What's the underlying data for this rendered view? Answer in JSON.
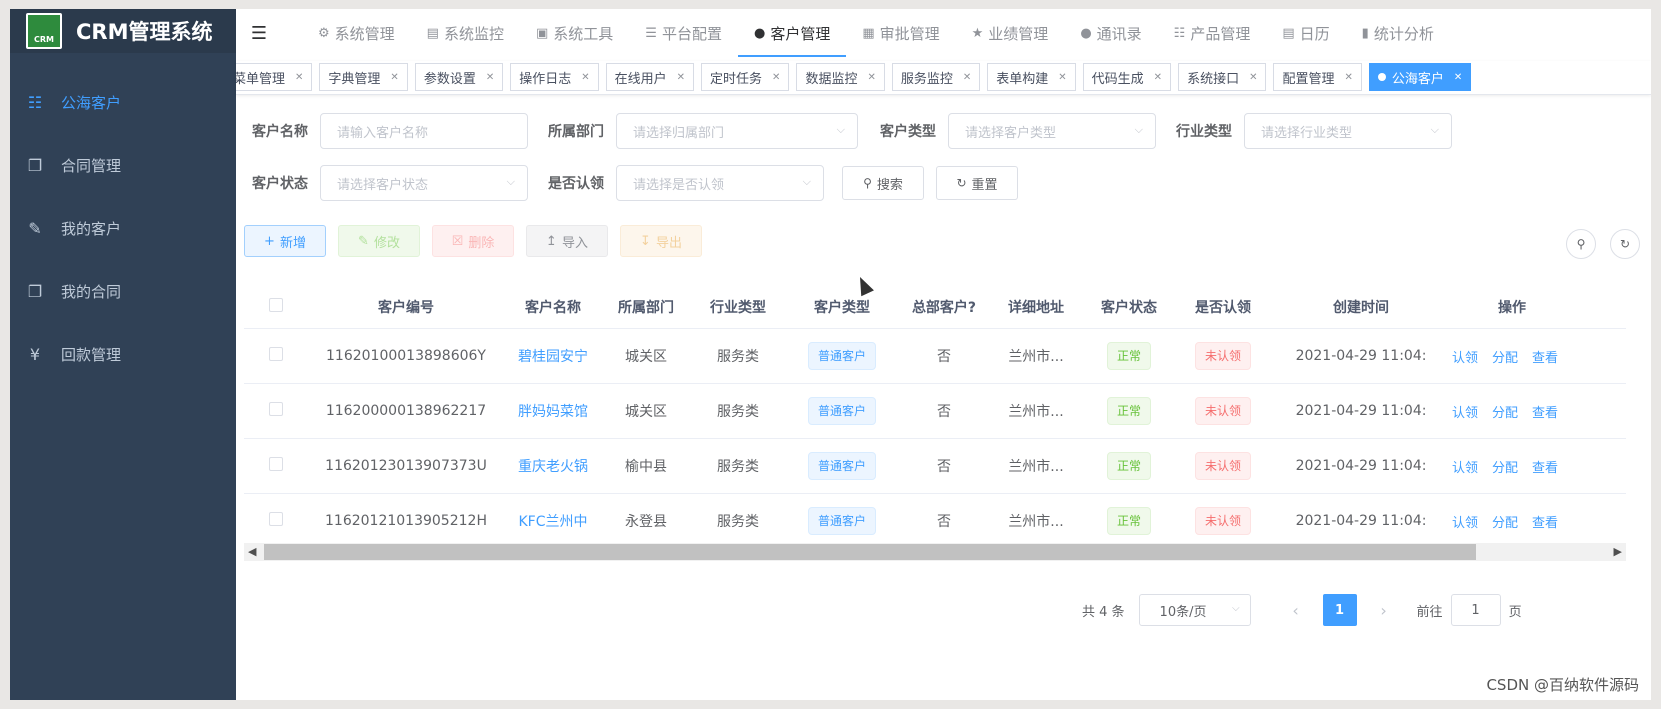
{
  "app": {
    "title": "CRM管理系统",
    "logo_text": "CRM"
  },
  "sidebar": {
    "items": [
      {
        "label": "公海客户",
        "icon": "org-tree-icon",
        "active": true
      },
      {
        "label": "合同管理",
        "icon": "documents-icon"
      },
      {
        "label": "我的客户",
        "icon": "edit-icon"
      },
      {
        "label": "我的合同",
        "icon": "documents-icon"
      },
      {
        "label": "回款管理",
        "icon": "yen-icon"
      }
    ]
  },
  "topnav": {
    "items": [
      {
        "label": "系统管理",
        "icon": "gear-icon"
      },
      {
        "label": "系统监控",
        "icon": "monitor-icon"
      },
      {
        "label": "系统工具",
        "icon": "toolbox-icon"
      },
      {
        "label": "平台配置",
        "icon": "list-icon"
      },
      {
        "label": "客户管理",
        "icon": "user-icon",
        "active": true
      },
      {
        "label": "审批管理",
        "icon": "grid-icon"
      },
      {
        "label": "业绩管理",
        "icon": "star-icon"
      },
      {
        "label": "通讯录",
        "icon": "user-icon"
      },
      {
        "label": "产品管理",
        "icon": "cart-icon"
      },
      {
        "label": "日历",
        "icon": "calendar-icon"
      },
      {
        "label": "统计分析",
        "icon": "bar-chart-icon"
      }
    ]
  },
  "tags": [
    {
      "label": "菜单管理"
    },
    {
      "label": "字典管理"
    },
    {
      "label": "参数设置"
    },
    {
      "label": "操作日志"
    },
    {
      "label": "在线用户"
    },
    {
      "label": "定时任务"
    },
    {
      "label": "数据监控"
    },
    {
      "label": "服务监控"
    },
    {
      "label": "表单构建"
    },
    {
      "label": "代码生成"
    },
    {
      "label": "系统接口"
    },
    {
      "label": "配置管理"
    },
    {
      "label": "公海客户",
      "active": true
    }
  ],
  "search": {
    "customer_name": {
      "label": "客户名称",
      "placeholder": "请输入客户名称"
    },
    "department": {
      "label": "所属部门",
      "placeholder": "请选择归属部门"
    },
    "customer_type": {
      "label": "客户类型",
      "placeholder": "请选择客户类型"
    },
    "industry": {
      "label": "行业类型",
      "placeholder": "请选择行业类型"
    },
    "status": {
      "label": "客户状态",
      "placeholder": "请选择客户状态"
    },
    "claimed": {
      "label": "是否认领",
      "placeholder": "请选择是否认领"
    },
    "search_btn": "搜索",
    "reset_btn": "重置"
  },
  "toolbar": {
    "add": "新增",
    "edit": "修改",
    "delete": "删除",
    "import": "导入",
    "export": "导出"
  },
  "table": {
    "headers": [
      "客户编号",
      "客户名称",
      "所属部门",
      "行业类型",
      "客户类型",
      "总部客户?",
      "详细地址",
      "客户状态",
      "是否认领",
      "创建时间",
      "操作"
    ],
    "rows": [
      {
        "id": "11620100013898606Y",
        "name": "碧桂园安宁",
        "dept": "城关区",
        "industry": "服务类",
        "type": "普通客户",
        "hq": "否",
        "address": "兰州市...",
        "status": "正常",
        "claimed": "未认领",
        "created": "2021-04-29 11:04:"
      },
      {
        "id": "116200000138962217",
        "name": "胖妈妈菜馆",
        "dept": "城关区",
        "industry": "服务类",
        "type": "普通客户",
        "hq": "否",
        "address": "兰州市...",
        "status": "正常",
        "claimed": "未认领",
        "created": "2021-04-29 11:04:"
      },
      {
        "id": "11620123013907373U",
        "name": "重庆老火锅",
        "dept": "榆中县",
        "industry": "服务类",
        "type": "普通客户",
        "hq": "否",
        "address": "兰州市...",
        "status": "正常",
        "claimed": "未认领",
        "created": "2021-04-29 11:04:"
      },
      {
        "id": "11620121013905212H",
        "name": "KFC兰州中",
        "dept": "永登县",
        "industry": "服务类",
        "type": "普通客户",
        "hq": "否",
        "address": "兰州市...",
        "status": "正常",
        "claimed": "未认领",
        "created": "2021-04-29 11:04:"
      }
    ],
    "ops": [
      "认领",
      "分配",
      "查看"
    ]
  },
  "pagination": {
    "total": "共 4 条",
    "page_size": "10条/页",
    "current": "1",
    "jump_label": "前往",
    "jump_value": "1",
    "page_suffix": "页"
  },
  "watermark": "CSDN @百纳软件源码",
  "colors": {
    "primary": "#409eff",
    "sidebar": "#304156",
    "success": "#67c23a",
    "danger": "#f56c6c"
  }
}
